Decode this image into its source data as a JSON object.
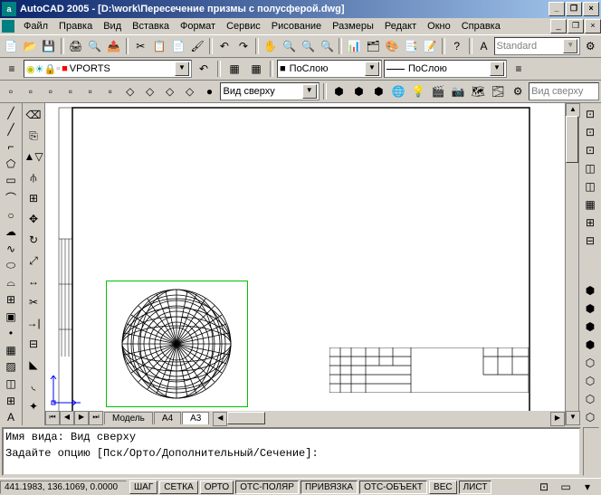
{
  "title": "AutoCAD 2005 - [D:\\work\\Пересечение призмы с полусферой.dwg]",
  "menu": [
    "Файл",
    "Правка",
    "Вид",
    "Вставка",
    "Формат",
    "Сервис",
    "Рисование",
    "Размеры",
    "Редакт",
    "Окно",
    "Справка"
  ],
  "style_combo": "Standard",
  "layer_combo": "VPORTS",
  "linetype_combo": "ПоСлою",
  "lineweight_combo": "ПоСлою",
  "view_combo": "Вид сверху",
  "view_combo2": "Вид сверху",
  "tabs": {
    "model": "Модель",
    "a4": "A4",
    "a3": "A3"
  },
  "cmd_line1": "Имя вида: Вид сверху",
  "cmd_line2": "Задайте опцию [Пск/Орто/Дополнительный/Сечение]:",
  "coords": "441.1983, 136.1069, 0.0000",
  "status_buttons": [
    "ШАГ",
    "СЕТКА",
    "ОРТО",
    "ОТС-ПОЛЯР",
    "ПРИВЯЗКА",
    "ОТС-ОБЪЕКТ",
    "ВЕС",
    "ЛИСТ"
  ]
}
